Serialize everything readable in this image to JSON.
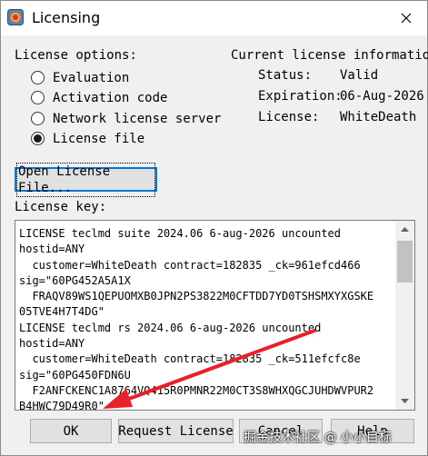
{
  "window": {
    "title": "Licensing"
  },
  "options": {
    "label": "License options:",
    "items": [
      {
        "label": "Evaluation",
        "selected": false
      },
      {
        "label": "Activation code",
        "selected": false
      },
      {
        "label": "Network license server",
        "selected": false
      },
      {
        "label": "License file",
        "selected": true
      }
    ]
  },
  "info": {
    "label": "Current license information",
    "status_label": "Status:",
    "status_value": "Valid",
    "expiration_label": "Expiration:",
    "expiration_value": "06-Aug-2026",
    "license_label": "License:",
    "license_value": "WhiteDeath"
  },
  "open_button": "Open License File...",
  "key": {
    "label": "License key:",
    "text": "LICENSE teclmd suite 2024.06 6-aug-2026 uncounted\nhostid=ANY\n  customer=WhiteDeath contract=182835 _ck=961efcd466\nsig=\"60PG452A5A1X\n  FRAQV89WS1QEPUOMXB0JPN2PS3822M0CFTDD7YD0TSHSMXYXGSKE\n05TVE4H7T4DG\"\nLICENSE teclmd rs 2024.06 6-aug-2026 uncounted\nhostid=ANY\n  customer=WhiteDeath contract=182835 _ck=511efcfc8e\nsig=\"60PG450FDN6U\n  F2ANFCKENC1A8764VQ415R0PMNR22M0CT3S8WHXQGCJUHDWVPUR2\nB4HWC79D49R0\""
  },
  "buttons": {
    "ok": "OK",
    "request": "Request License",
    "cancel": "Cancel",
    "help": "Help"
  },
  "watermark": "掘金技术社区 @ 小小目标",
  "colors": {
    "focus_border": "#0078d7",
    "annotation_arrow": "#e8202a"
  },
  "icons": {
    "app": "app-logo-icon",
    "close": "close-icon"
  }
}
